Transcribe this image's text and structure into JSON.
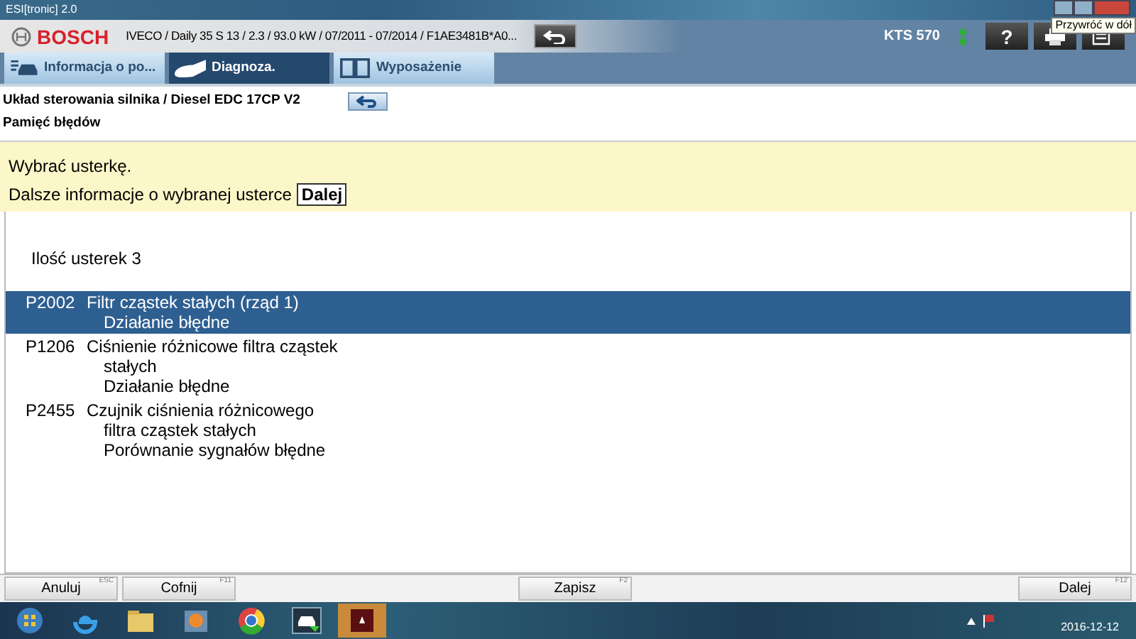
{
  "window": {
    "title": "ESI[tronic] 2.0",
    "tooltip": "Przywróć w dół"
  },
  "header": {
    "brand": "BOSCH",
    "vehicle": "IVECO / Daily 35 S 13 / 2.3 / 93.0 kW / 07/2011 - 07/2014 / F1AE3481B*A0...",
    "device": "KTS 570",
    "help": "?"
  },
  "tabs": [
    {
      "label": "Informacja o po...",
      "selected": false,
      "kind": "car"
    },
    {
      "label": "Diagnoza.",
      "selected": true,
      "kind": "plug"
    },
    {
      "label": "Wyposażenie",
      "selected": false,
      "kind": "book"
    }
  ],
  "breadcrumb": {
    "path": "Układ sterowania silnika / Diesel EDC 17CP V2",
    "page": "Pamięć błędów"
  },
  "hint": {
    "line1": "Wybrać usterkę.",
    "line2": "Dalsze informacje o wybranej usterce",
    "key": "Dalej"
  },
  "count": "Ilość usterek 3",
  "faults": [
    {
      "code": "P2002",
      "lines": [
        "Filtr cząstek stałych (rząd 1)",
        "Działanie błędne"
      ],
      "selected": true
    },
    {
      "code": "P1206",
      "lines": [
        "Ciśnienie różnicowe filtra cząstek",
        "stałych",
        "Działanie błędne"
      ],
      "selected": false
    },
    {
      "code": "P2455",
      "lines": [
        "Czujnik ciśnienia różnicowego",
        "filtra cząstek stałych",
        "Porównanie sygnałów błędne"
      ],
      "selected": false
    }
  ],
  "buttons": [
    {
      "label": "Anuluj",
      "key": "ESC"
    },
    {
      "label": "Cofnij",
      "key": "F11"
    },
    {
      "label": "Zapisz",
      "key": "F2"
    },
    {
      "label": "Dalej",
      "key": "F12"
    }
  ],
  "taskbar": {
    "date": "2016-12-12"
  }
}
